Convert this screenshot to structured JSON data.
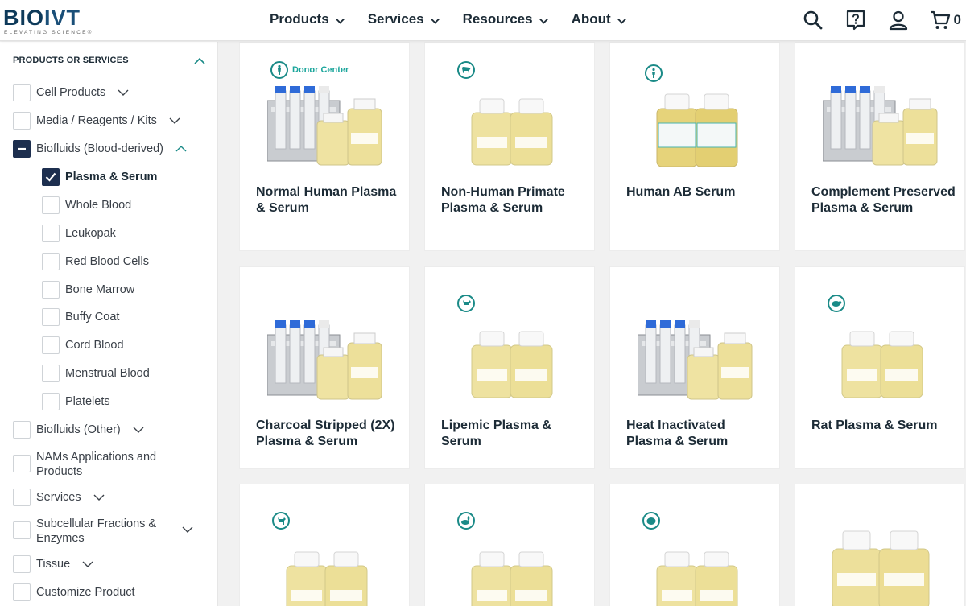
{
  "brand": {
    "logo_text_bio": "BIO",
    "logo_text_ivt": "IVT",
    "tagline": "ELEVATING SCIENCE®"
  },
  "nav": {
    "items": [
      {
        "label": "Products"
      },
      {
        "label": "Services"
      },
      {
        "label": "Resources"
      },
      {
        "label": "About"
      }
    ],
    "cart_count": "0",
    "icons": [
      "search-icon",
      "help-icon",
      "account-icon",
      "cart-icon"
    ]
  },
  "sidebar": {
    "title": "PRODUCTS OR SERVICES",
    "filters": [
      {
        "label": "Cell Products",
        "state": "unchecked",
        "expandable": true
      },
      {
        "label": "Media / Reagents / Kits",
        "state": "unchecked",
        "expandable": true
      },
      {
        "label": "Biofluids (Blood-derived)",
        "state": "partial",
        "expandable": true,
        "expanded": true
      },
      {
        "label": "Plasma & Serum",
        "state": "checked",
        "sub": true
      },
      {
        "label": "Whole Blood",
        "state": "unchecked",
        "sub": true
      },
      {
        "label": "Leukopak",
        "state": "unchecked",
        "sub": true
      },
      {
        "label": "Red Blood Cells",
        "state": "unchecked",
        "sub": true
      },
      {
        "label": "Bone Marrow",
        "state": "unchecked",
        "sub": true
      },
      {
        "label": "Buffy Coat",
        "state": "unchecked",
        "sub": true
      },
      {
        "label": "Cord Blood",
        "state": "unchecked",
        "sub": true
      },
      {
        "label": "Menstrual Blood",
        "state": "unchecked",
        "sub": true
      },
      {
        "label": "Platelets",
        "state": "unchecked",
        "sub": true
      },
      {
        "label": "Biofluids (Other)",
        "state": "unchecked",
        "expandable": true
      },
      {
        "label": "NAMs Applications and Products",
        "state": "unchecked"
      },
      {
        "label": "Services",
        "state": "unchecked",
        "expandable": true
      },
      {
        "label": "Subcellular Fractions & Enzymes",
        "state": "unchecked",
        "expandable": true
      },
      {
        "label": "Tissue",
        "state": "unchecked",
        "expandable": true
      },
      {
        "label": "Customize Product",
        "state": "unchecked"
      }
    ]
  },
  "products": [
    {
      "title": "Normal Human Plasma & Serum",
      "badge": "human-icon",
      "badge_text": "Donor Center",
      "image": "rack"
    },
    {
      "title": "Non-Human Primate Plasma & Serum",
      "badge": "primate-icon",
      "image": "bottles"
    },
    {
      "title": "Human AB Serum",
      "badge": "human-icon",
      "image": "bottles-labeled"
    },
    {
      "title": "Complement Preserved Plasma & Serum",
      "image": "rack"
    },
    {
      "title": "Charcoal Stripped (2X) Plasma & Serum",
      "image": "rack"
    },
    {
      "title": "Lipemic Plasma & Serum",
      "badge": "dog-icon",
      "image": "bottles"
    },
    {
      "title": "Heat Inactivated Plasma & Serum",
      "image": "rack"
    },
    {
      "title": "Rat Plasma & Serum",
      "badge": "rat-icon",
      "image": "bottles"
    },
    {
      "title": "",
      "badge": "dog-icon",
      "image": "bottles"
    },
    {
      "title": "",
      "badge": "rabbit-icon",
      "image": "bottles"
    },
    {
      "title": "",
      "badge": "guinea-pig-icon",
      "image": "bottles"
    },
    {
      "title": "",
      "image": "bottles-large"
    }
  ],
  "colors": {
    "navy": "#1d2f4f",
    "teal": "#1a8a87",
    "serum": "#e9d67a"
  }
}
